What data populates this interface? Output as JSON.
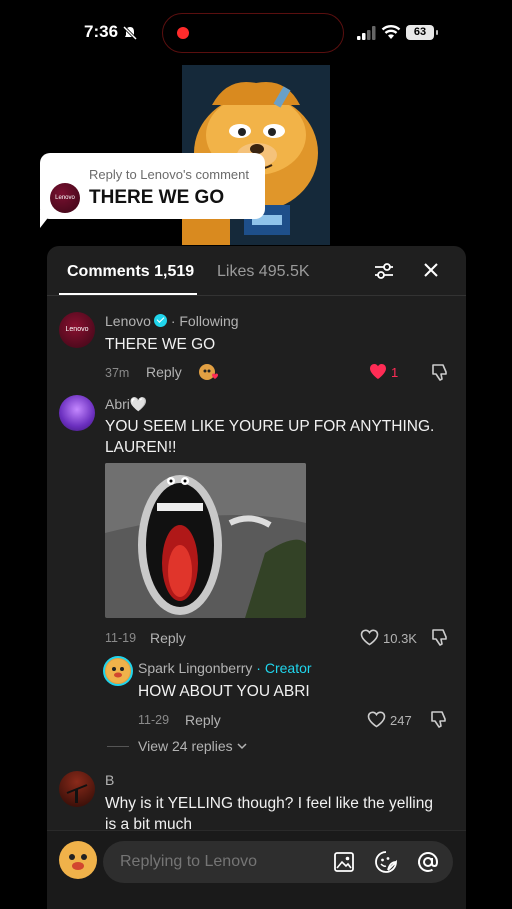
{
  "status_bar": {
    "time": "7:36",
    "battery": "63"
  },
  "sticker": {
    "reply_to": "Reply to Lenovo's comment",
    "text": "THERE WE GO",
    "avatar_label": "Lenovo"
  },
  "panel": {
    "tabs": [
      {
        "label": "Comments 1,519"
      },
      {
        "label": "Likes 495.5K"
      }
    ]
  },
  "comments": [
    {
      "username": "Lenovo",
      "following_label": "· Following",
      "avatar_label": "Lenovo",
      "text": "THERE WE GO",
      "time": "37m",
      "reply_label": "Reply",
      "like_count": "1"
    },
    {
      "username": "Abri🤍",
      "text_line1": "YOU SEEM LIKE YOURE UP FOR ANYTHING.",
      "text_line2": "LAUREN!!",
      "time": "11-19",
      "reply_label": "Reply",
      "like_count": "10.3K"
    },
    {
      "username": "B",
      "text_line1": "Why is it YELLING though? I feel like the yelling",
      "text_line2": "is a bit much"
    }
  ],
  "reply": {
    "username": "Spark Lingonberry",
    "creator_label": "· Creator",
    "text": "HOW ABOUT YOU ABRI",
    "time": "11-29",
    "reply_label": "Reply",
    "like_count": "247"
  },
  "view_replies": "View 24 replies",
  "input": {
    "placeholder": "Replying to Lenovo"
  },
  "colors": {
    "accent_heart": "#fe2c55",
    "creator": "#20d5ec",
    "panel_bg": "#1f1f1f"
  }
}
